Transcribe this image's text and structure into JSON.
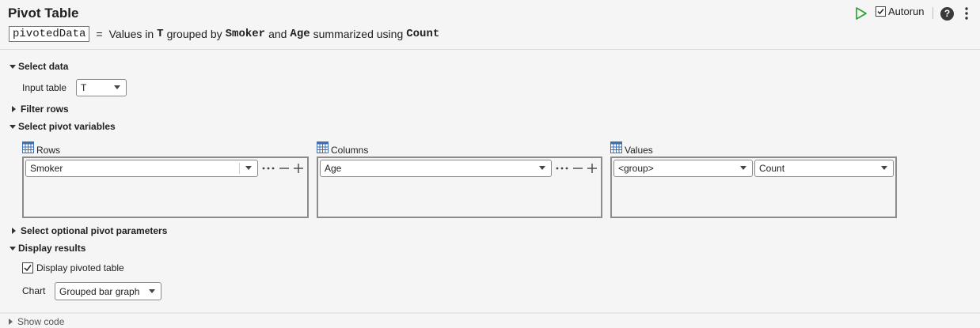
{
  "header": {
    "title": "Pivot Table",
    "autorun_label": "Autorun",
    "autorun_checked": true,
    "help_label": "?"
  },
  "summary": {
    "output_var": "pivotedData",
    "equals": "=",
    "text1": "Values in",
    "table": "T",
    "text2": "grouped by",
    "rows_var": "Smoker",
    "text3": "and",
    "cols_var": "Age",
    "text4": "summarized using",
    "method": "Count"
  },
  "sections": {
    "select_data": "Select data",
    "filter_rows": "Filter rows",
    "select_pivot": "Select pivot variables",
    "optional": "Select optional pivot parameters",
    "display": "Display results"
  },
  "select_data": {
    "input_table_label": "Input table",
    "input_table_value": "T"
  },
  "pivot": {
    "rows": {
      "label": "Rows",
      "value": "Smoker"
    },
    "columns": {
      "label": "Columns",
      "value": "Age"
    },
    "values": {
      "label": "Values",
      "group_value": "<group>",
      "method_value": "Count"
    }
  },
  "display": {
    "display_table_label": "Display pivoted table",
    "display_table_checked": true,
    "chart_label": "Chart",
    "chart_value": "Grouped bar graph"
  },
  "footer": {
    "show_code": "Show code"
  },
  "icons": [
    "run-icon",
    "help-icon",
    "kebab-icon",
    "table-grid-icon",
    "ellipsis-icon",
    "minus-icon",
    "plus-icon",
    "caret-icon"
  ],
  "colors": {
    "run_green": "#2aa02a",
    "grid_blue": "#3b6fb6"
  }
}
